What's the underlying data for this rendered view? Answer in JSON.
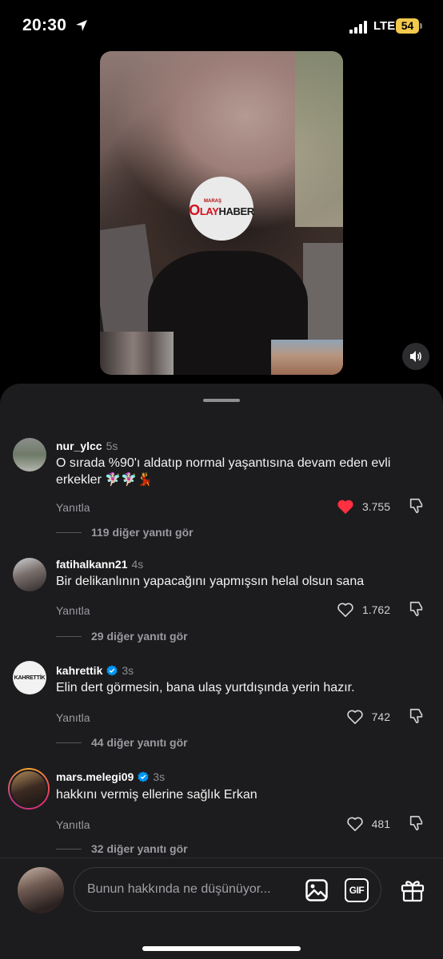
{
  "status_bar": {
    "time": "20:30",
    "network": "LTE",
    "battery": "54"
  },
  "video": {
    "logo": {
      "small": "MARAŞ",
      "o": "O",
      "lay": "LAY",
      "haber": "HABER"
    }
  },
  "comments": [
    {
      "username": "nur_ylcc",
      "time": "5s",
      "verified": false,
      "text": "O sırada %90'ı aldatıp normal yaşantısına devam eden evli erkekler 🧚🏻‍♀️🧚🏻‍♀️💃",
      "reply_label": "Yanıtla",
      "likes": "3.755",
      "liked": true,
      "more_replies": "119 diğer yanıtı gör"
    },
    {
      "username": "fatihalkann21",
      "time": "4s",
      "verified": false,
      "text": "Bir delikanlının yapacağını yapmışsın helal olsun sana",
      "reply_label": "Yanıtla",
      "likes": "1.762",
      "liked": false,
      "more_replies": "29 diğer yanıtı gör"
    },
    {
      "username": "kahrettik",
      "time": "3s",
      "verified": true,
      "avatar_text": "KAHRETTİK",
      "text": "Elin dert görmesin, bana ulaş yurtdışında yerin hazır.",
      "reply_label": "Yanıtla",
      "likes": "742",
      "liked": false,
      "more_replies": "44 diğer yanıtı gör"
    },
    {
      "username": "mars.melegi09",
      "time": "3s",
      "verified": true,
      "text": "hakkını vermiş ellerine sağlık Erkan",
      "reply_label": "Yanıtla",
      "likes": "481",
      "liked": false,
      "more_replies": "32 diğer yanıtı gör"
    }
  ],
  "composer": {
    "placeholder": "Bunun hakkında ne düşünüyor...",
    "gif_label": "GIF"
  },
  "colors": {
    "like_red": "#ff3040",
    "verified_blue": "#0095f6",
    "sheet_bg": "#1c1c1e"
  }
}
